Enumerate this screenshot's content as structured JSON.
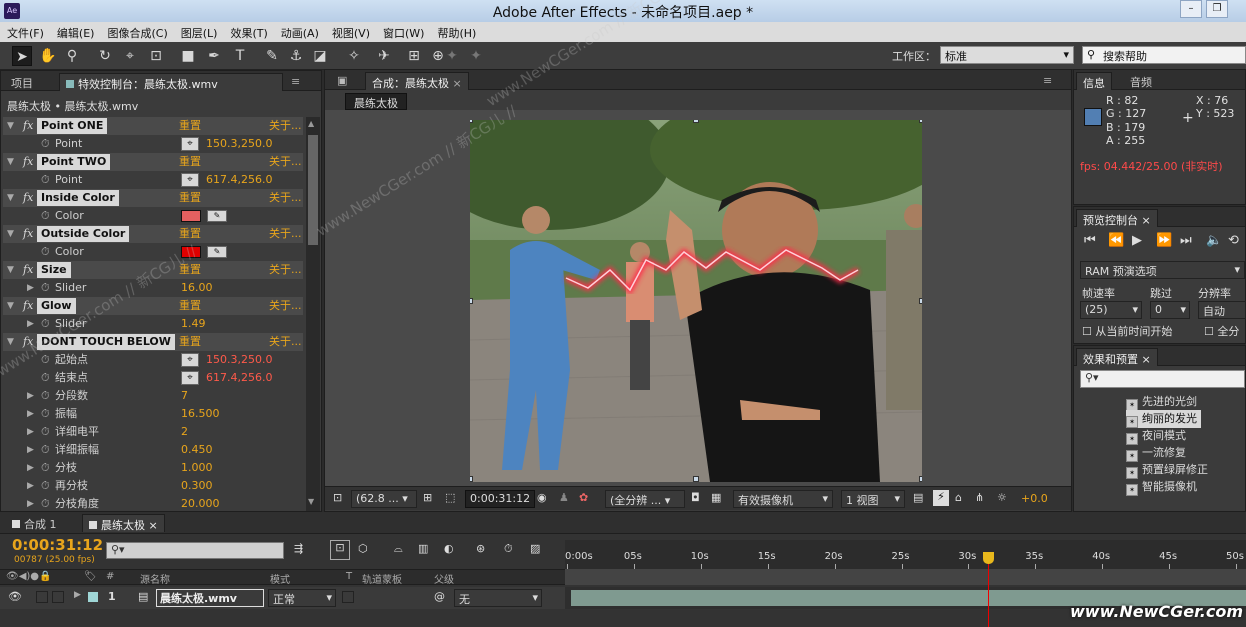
{
  "app": {
    "title": "Adobe After Effects - 未命名项目.aep *",
    "logo": "Ae"
  },
  "menu": [
    "文件(F)",
    "编辑(E)",
    "图像合成(C)",
    "图层(L)",
    "效果(T)",
    "动画(A)",
    "视图(V)",
    "窗口(W)",
    "帮助(H)"
  ],
  "workspace": {
    "label": "工作区：",
    "value": "标准"
  },
  "search": {
    "placeholder": "搜索帮助"
  },
  "left_panel": {
    "tab_project": "项目",
    "tab_effects": "特效控制台：晨练太极.wmv",
    "header": "晨练太极 • 晨练太极.wmv",
    "reset_label": "重置",
    "about_label": "关于...",
    "rows": [
      {
        "kind": "effect",
        "name": "Point ONE"
      },
      {
        "kind": "param",
        "name": "Point",
        "value": "150.3,250.0",
        "control": "point"
      },
      {
        "kind": "effect",
        "name": "Point TWO"
      },
      {
        "kind": "param",
        "name": "Point",
        "value": "617.4,256.0",
        "control": "point"
      },
      {
        "kind": "effect",
        "name": "Inside Color"
      },
      {
        "kind": "param",
        "name": "Color",
        "value": "",
        "control": "swatch",
        "color": "#e46060"
      },
      {
        "kind": "effect",
        "name": "Outside Color"
      },
      {
        "kind": "param",
        "name": "Color",
        "value": "",
        "control": "swatch",
        "color": "#e00000"
      },
      {
        "kind": "effect",
        "name": "Size"
      },
      {
        "kind": "param",
        "name": "Slider",
        "value": "16.00",
        "control": "expand"
      },
      {
        "kind": "effect",
        "name": "Glow"
      },
      {
        "kind": "param",
        "name": "Slider",
        "value": "1.49",
        "control": "expand"
      },
      {
        "kind": "effect",
        "name": "DONT TOUCH BELOW"
      },
      {
        "kind": "param",
        "name": "起始点",
        "value": "150.3,250.0",
        "control": "point",
        "red": true
      },
      {
        "kind": "param",
        "name": "结束点",
        "value": "617.4,256.0",
        "control": "point",
        "red": true
      },
      {
        "kind": "param",
        "name": "分段数",
        "value": "7",
        "control": "expand"
      },
      {
        "kind": "param",
        "name": "振幅",
        "value": "16.500",
        "control": "expand"
      },
      {
        "kind": "param",
        "name": "详细电平",
        "value": "2",
        "control": "expand"
      },
      {
        "kind": "param",
        "name": "详细振幅",
        "value": "0.450",
        "control": "expand"
      },
      {
        "kind": "param",
        "name": "分枝",
        "value": "1.000",
        "control": "expand"
      },
      {
        "kind": "param",
        "name": "再分枝",
        "value": "0.300",
        "control": "expand"
      },
      {
        "kind": "param",
        "name": "分枝角度",
        "value": "20.000",
        "control": "expand"
      }
    ]
  },
  "viewer": {
    "tab": "合成：晨练太极",
    "comp_button": "晨练太极",
    "footer": {
      "zoom": "(62.8 ...",
      "timecode": "0:00:31:12",
      "resolution": "(全分辨 ...",
      "camera": "有效摄像机",
      "views": "1 视图",
      "offset": "+0.0"
    }
  },
  "info": {
    "tab_info": "信息",
    "tab_audio": "音频",
    "r": "R : 82",
    "g": "G : 127",
    "b": "B : 179",
    "a": "A : 255",
    "x": "X : 76",
    "y": "Y : 523",
    "swatch": "#527fb3",
    "fps": "fps: 04.442/25.00 (非实时)"
  },
  "preview": {
    "tab": "预览控制台",
    "ram": "RAM 预演选项",
    "frame_rate_label": "帧速率",
    "skip_label": "跳过",
    "resolution_label": "分辨率",
    "frame_rate": "(25)",
    "skip": "0",
    "resolution": "自动",
    "from_current": "从当前时间开始",
    "full_screen": "全分"
  },
  "effects_presets": {
    "tab": "效果和预置",
    "items": [
      "先进的光剑",
      "绚丽的发光",
      "夜间模式",
      "一流修复",
      "预置绿屏修正",
      "智能摄像机"
    ],
    "selected_index": 1
  },
  "timeline": {
    "tab_comp1": "合成 1",
    "tab_active": "晨练太极",
    "timecode": "0:00:31:12",
    "frames": "00787 (25.00 fps)",
    "col_source": "源名称",
    "col_mode": "模式",
    "col_t": "T",
    "col_track": "轨道蒙板",
    "col_parent": "父级",
    "layer_num": "1",
    "layer_name": "晨练太极.wmv",
    "layer_mode": "正常",
    "layer_parent": "无",
    "ruler": [
      "0:00s",
      "05s",
      "10s",
      "15s",
      "20s",
      "25s",
      "30s",
      "35s",
      "40s",
      "45s",
      "50s"
    ],
    "playhead_seconds": 31.5,
    "ruler_max_seconds": 50
  },
  "watermark": {
    "site": "www.NewCGer.com",
    "overlay": "www.NewCGer.com // 新CG儿 //"
  }
}
